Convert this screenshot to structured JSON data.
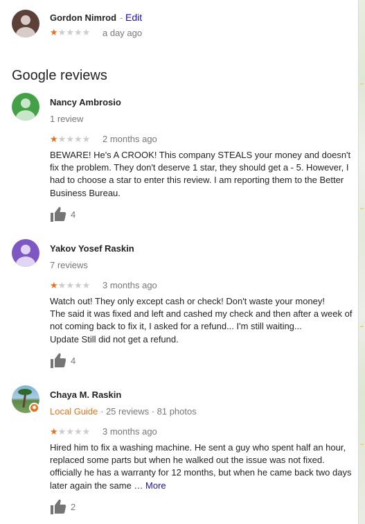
{
  "owner_review": {
    "author": "Gordon Nimrod",
    "separator": "-",
    "edit_label": "Edit",
    "rating": 1,
    "time": "a day ago"
  },
  "section_title": "Google reviews",
  "reviews": [
    {
      "author": "Nancy Ambrosio",
      "meta": "1 review",
      "rating": 1,
      "time": "2 months ago",
      "text": [
        "BEWARE! He's A CROOK! This company STEALS your money and doesn't fix the problem. They don't deserve 1 star, they should get a - 5. However, I had to choose a star to enter this review. I am reporting them to the Better Business Bureau."
      ],
      "likes": "4",
      "avatar_color": "#43a047"
    },
    {
      "author": "Yakov Yosef Raskin",
      "meta": "7 reviews",
      "rating": 1,
      "time": "3 months ago",
      "text": [
        "Watch out! They only except cash or check! Don't waste your money!",
        "The said it was fixed and left and cashed my check and then after a week of not coming back to fix it, I asked for a refund... I'm still waiting...",
        "Update Still did not get a refund."
      ],
      "likes": "4",
      "avatar_color": "#7e57c2"
    },
    {
      "author": "Chaya M. Raskin",
      "meta_guide": "Local Guide",
      "meta_rest": " · 25 reviews · 81 photos",
      "rating": 1,
      "time": "3 months ago",
      "text": [
        "Hired him to fix a washing machine. He sent a guy who spent half an hour, replaced some parts but when he walked out the issue was not fixed. officially he has a warranty for 12 months, but when he came back two days later again the same … "
      ],
      "more_label": "More",
      "likes": "2"
    }
  ],
  "colors": {
    "star_on": "#e7711b",
    "star_off": "#cccccc",
    "link": "#1a0dab",
    "local_guide": "#e7711b"
  },
  "icons": [
    "person-avatar-icon",
    "star-icon",
    "thumbs-up-icon",
    "local-guide-badge-icon"
  ]
}
